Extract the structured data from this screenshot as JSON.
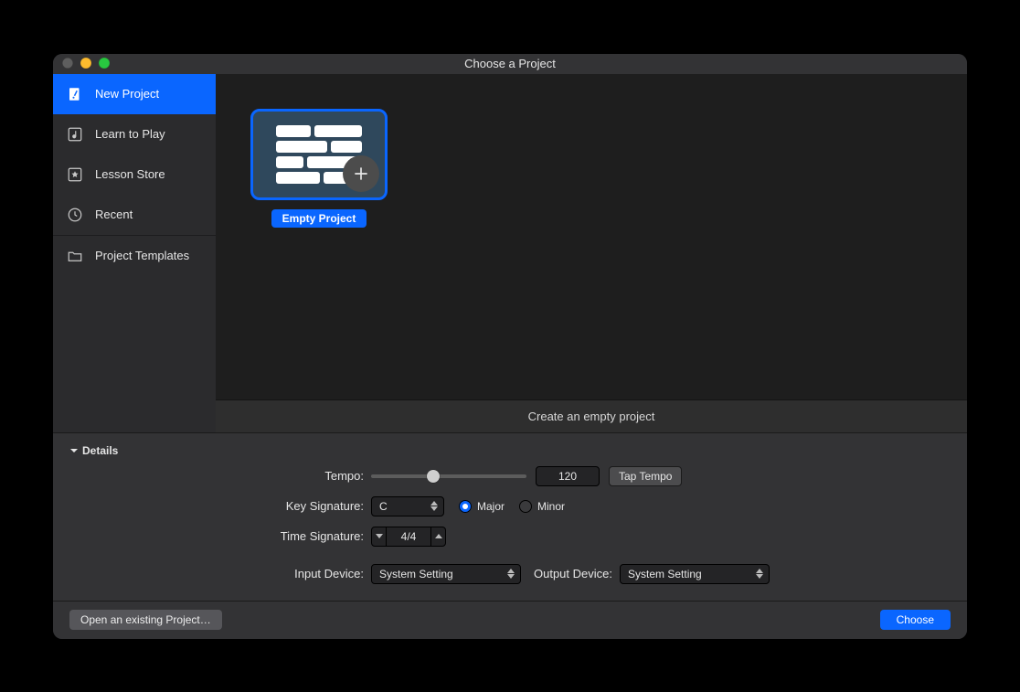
{
  "window": {
    "title": "Choose a Project"
  },
  "sidebar": {
    "items": [
      {
        "label": "New Project"
      },
      {
        "label": "Learn to Play"
      },
      {
        "label": "Lesson Store"
      },
      {
        "label": "Recent"
      },
      {
        "label": "Project Templates"
      }
    ]
  },
  "template": {
    "selected_label": "Empty Project",
    "description": "Create an empty project"
  },
  "details": {
    "header": "Details",
    "tempo_label": "Tempo:",
    "tempo_value": "120",
    "tap_tempo_label": "Tap Tempo",
    "key_sig_label": "Key Signature:",
    "key_value": "C",
    "major_label": "Major",
    "minor_label": "Minor",
    "time_sig_label": "Time Signature:",
    "time_sig_value": "4/4",
    "input_device_label": "Input Device:",
    "input_device_value": "System Setting",
    "output_device_label": "Output Device:",
    "output_device_value": "System Setting"
  },
  "footer": {
    "open_label": "Open an existing Project…",
    "choose_label": "Choose"
  }
}
